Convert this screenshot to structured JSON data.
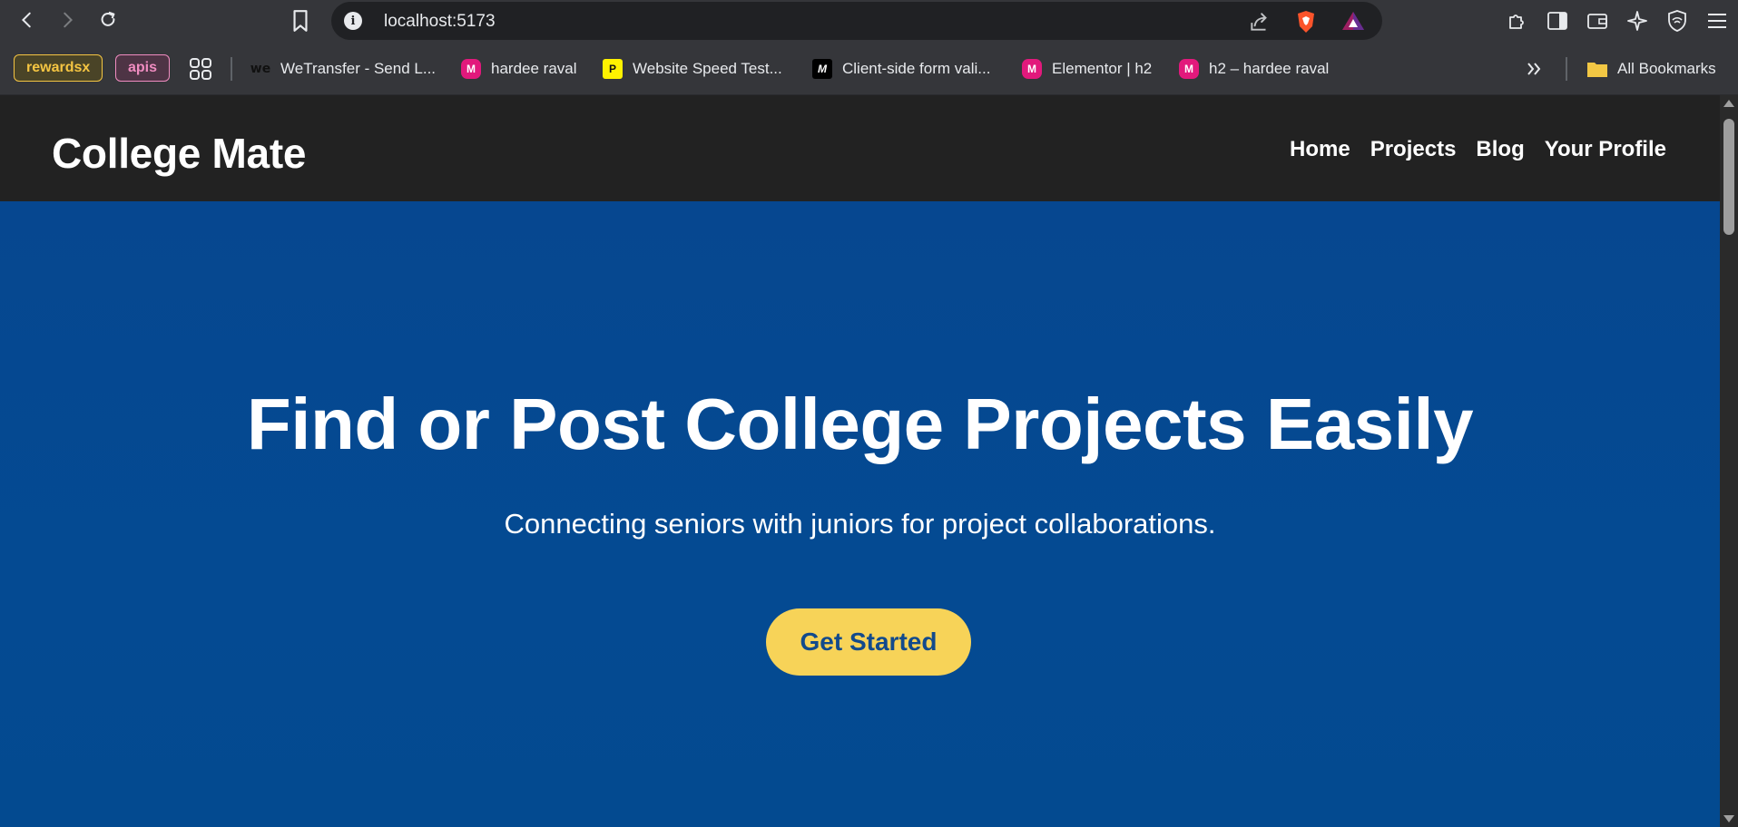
{
  "browser": {
    "url": "localhost:5173",
    "bookmarks": {
      "chips": [
        "rewardsx",
        "apis"
      ],
      "items": [
        {
          "label": "WeTransfer - Send L...",
          "icon": "wetransfer-icon"
        },
        {
          "label": "hardee raval",
          "icon": "elementor-site-icon"
        },
        {
          "label": "Website Speed Test...",
          "icon": "pingdom-icon"
        },
        {
          "label": "Client-side form vali...",
          "icon": "mdn-icon"
        },
        {
          "label": "Elementor | h2",
          "icon": "elementor-site-icon"
        },
        {
          "label": "h2 – hardee raval",
          "icon": "elementor-site-icon"
        }
      ],
      "all_bookmarks": "All Bookmarks"
    },
    "colors": {
      "chrome": "#35363a",
      "omnibox": "#202124",
      "brave": "#fb542b"
    }
  },
  "site": {
    "logo": "College Mate",
    "nav": [
      "Home",
      "Projects",
      "Blog",
      "Your Profile"
    ],
    "hero": {
      "title": "Find or Post College Projects Easily",
      "subtitle": "Connecting seniors with juniors for project collaborations.",
      "cta": "Get Started"
    },
    "colors": {
      "header": "#222222",
      "hero": "#044a92",
      "cta": "#f7d358",
      "cta_text": "#124a8c"
    }
  }
}
